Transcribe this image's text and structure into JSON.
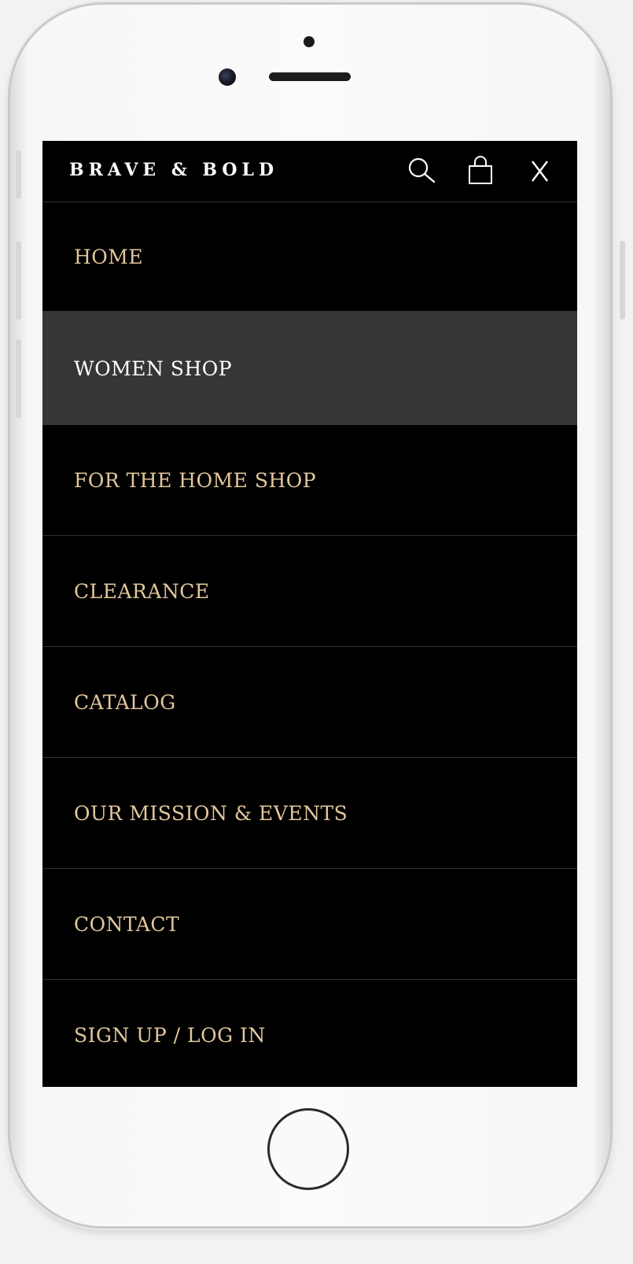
{
  "header": {
    "logo": "BRAVE & BOLD",
    "icons": [
      "search-icon",
      "shopping-bag-icon",
      "close-icon"
    ]
  },
  "menu": {
    "items": [
      {
        "label": "HOME",
        "active": false
      },
      {
        "label": "WOMEN SHOP",
        "active": true
      },
      {
        "label": "FOR THE HOME SHOP",
        "active": false
      },
      {
        "label": "CLEARANCE",
        "active": false
      },
      {
        "label": "CATALOG",
        "active": false
      },
      {
        "label": "OUR MISSION & EVENTS",
        "active": false
      },
      {
        "label": "CONTACT",
        "active": false
      },
      {
        "label": "SIGN UP / LOG IN",
        "active": false
      }
    ]
  },
  "colors": {
    "background": "#000000",
    "menu_text": "#e3c79c",
    "active_background": "#363636",
    "active_text": "#ffffff",
    "divider": "#3a3226"
  }
}
